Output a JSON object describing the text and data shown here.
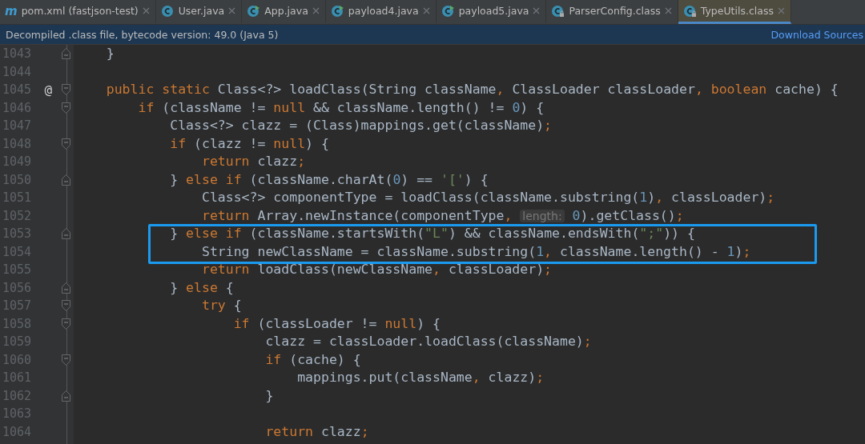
{
  "tabs": [
    {
      "label": "pom.xml (fastjson-test)",
      "kind": "maven",
      "icon_letter": "m",
      "selected": false
    },
    {
      "label": "User.java",
      "kind": "class",
      "selected": false
    },
    {
      "label": "App.java",
      "kind": "runnable",
      "selected": false
    },
    {
      "label": "payload4.java",
      "kind": "runnable",
      "selected": false
    },
    {
      "label": "payload5.java",
      "kind": "runnable",
      "selected": false
    },
    {
      "label": "ParserConfig.class",
      "kind": "locked",
      "selected": false
    },
    {
      "label": "TypeUtils.class",
      "kind": "locked",
      "selected": true
    }
  ],
  "banner": {
    "message": "Decompiled .class file, bytecode version: 49.0 (Java 5)",
    "link": "Download Sources"
  },
  "lines": [
    {
      "number": "1043",
      "fold_start": false,
      "fold_end": true,
      "boxed": false,
      "tokens": [
        {
          "kind": "plain",
          "text": "    }"
        }
      ]
    },
    {
      "number": "1044",
      "fold_start": false,
      "fold_end": false,
      "boxed": false
    },
    {
      "number": "1045",
      "marker": "@",
      "fold_start": true,
      "fold_end": false,
      "boxed": false,
      "tokens": [
        {
          "kind": "kw",
          "text": "    public static"
        },
        {
          "kind": "plain",
          "text": " Class<?> loadClass(String className"
        },
        {
          "kind": "punct",
          "text": ","
        },
        {
          "kind": "plain",
          "text": " ClassLoader classLoader"
        },
        {
          "kind": "punct",
          "text": ","
        },
        {
          "kind": "kw",
          "text": " boolean"
        },
        {
          "kind": "plain",
          "text": " cache) {"
        }
      ]
    },
    {
      "number": "1046",
      "fold_start": true,
      "fold_end": false,
      "boxed": false,
      "tokens": [
        {
          "kind": "kw",
          "text": "        if"
        },
        {
          "kind": "plain",
          "text": " (className != "
        },
        {
          "kind": "kw",
          "text": "null"
        },
        {
          "kind": "plain",
          "text": " && className.length() != "
        },
        {
          "kind": "num",
          "text": "0"
        },
        {
          "kind": "plain",
          "text": ") {"
        }
      ]
    },
    {
      "number": "1047",
      "fold_start": false,
      "fold_end": false,
      "boxed": false,
      "tokens": [
        {
          "kind": "plain",
          "text": "            Class<?> clazz = (Class)mappings.get(className)"
        },
        {
          "kind": "punct",
          "text": ";"
        }
      ]
    },
    {
      "number": "1048",
      "fold_start": true,
      "fold_end": false,
      "boxed": false,
      "tokens": [
        {
          "kind": "kw",
          "text": "            if"
        },
        {
          "kind": "plain",
          "text": " (clazz != "
        },
        {
          "kind": "kw",
          "text": "null"
        },
        {
          "kind": "plain",
          "text": ") {"
        }
      ]
    },
    {
      "number": "1049",
      "fold_start": false,
      "fold_end": false,
      "boxed": false,
      "tokens": [
        {
          "kind": "kw",
          "text": "                return"
        },
        {
          "kind": "plain",
          "text": " clazz"
        },
        {
          "kind": "punct",
          "text": ";"
        }
      ]
    },
    {
      "number": "1050",
      "fold_start": false,
      "fold_end": true,
      "boxed": false,
      "tokens": [
        {
          "kind": "plain",
          "text": "            } "
        },
        {
          "kind": "kw",
          "text": "else if"
        },
        {
          "kind": "plain",
          "text": " (className.charAt("
        },
        {
          "kind": "num",
          "text": "0"
        },
        {
          "kind": "plain",
          "text": ") == "
        },
        {
          "kind": "str",
          "text": "'['"
        },
        {
          "kind": "plain",
          "text": ") {"
        }
      ]
    },
    {
      "number": "1051",
      "fold_start": false,
      "fold_end": false,
      "boxed": false,
      "tokens": [
        {
          "kind": "plain",
          "text": "                Class<?> componentType = loadClass(className.substring("
        },
        {
          "kind": "num",
          "text": "1"
        },
        {
          "kind": "plain",
          "text": ")"
        },
        {
          "kind": "punct",
          "text": ","
        },
        {
          "kind": "plain",
          "text": " classLoader)"
        },
        {
          "kind": "punct",
          "text": ";"
        }
      ]
    },
    {
      "number": "1052",
      "fold_start": false,
      "fold_end": false,
      "boxed": false,
      "tokens": [
        {
          "kind": "kw",
          "text": "                return"
        },
        {
          "kind": "plain",
          "text": " Array.newInstance(componentType"
        },
        {
          "kind": "punct",
          "text": ","
        },
        {
          "kind": "hint",
          "text": "length:"
        },
        {
          "kind": "num",
          "text": "0"
        },
        {
          "kind": "plain",
          "text": ").getClass()"
        },
        {
          "kind": "punct",
          "text": ";"
        }
      ]
    },
    {
      "number": "1053",
      "fold_start": false,
      "fold_end": true,
      "boxed": true,
      "tokens": [
        {
          "kind": "plain",
          "text": "            } "
        },
        {
          "kind": "kw",
          "text": "else if"
        },
        {
          "kind": "plain",
          "text": " (className.startsWith("
        },
        {
          "kind": "str",
          "text": "\"L\""
        },
        {
          "kind": "plain",
          "text": ") && className.endsWith("
        },
        {
          "kind": "str",
          "text": "\";\""
        },
        {
          "kind": "plain",
          "text": ")) {"
        }
      ]
    },
    {
      "number": "1054",
      "fold_start": false,
      "fold_end": false,
      "boxed": true,
      "tokens": [
        {
          "kind": "plain",
          "text": "                String newClassName = className.substring("
        },
        {
          "kind": "num",
          "text": "1"
        },
        {
          "kind": "punct",
          "text": ","
        },
        {
          "kind": "plain",
          "text": " className.length() - "
        },
        {
          "kind": "num",
          "text": "1"
        },
        {
          "kind": "plain",
          "text": ")"
        },
        {
          "kind": "punct",
          "text": ";"
        }
      ]
    },
    {
      "number": "1055",
      "fold_start": false,
      "fold_end": false,
      "boxed": false,
      "tokens": [
        {
          "kind": "kw",
          "text": "                return"
        },
        {
          "kind": "plain",
          "text": " loadClass(newClassName"
        },
        {
          "kind": "punct",
          "text": ","
        },
        {
          "kind": "plain",
          "text": " classLoader)"
        },
        {
          "kind": "punct",
          "text": ";"
        }
      ]
    },
    {
      "number": "1056",
      "fold_start": false,
      "fold_end": true,
      "boxed": false,
      "tokens": [
        {
          "kind": "plain",
          "text": "            } "
        },
        {
          "kind": "kw",
          "text": "else"
        },
        {
          "kind": "plain",
          "text": " {"
        }
      ]
    },
    {
      "number": "1057",
      "fold_start": true,
      "fold_end": false,
      "boxed": false,
      "tokens": [
        {
          "kind": "kw",
          "text": "                try"
        },
        {
          "kind": "plain",
          "text": " {"
        }
      ]
    },
    {
      "number": "1058",
      "fold_start": true,
      "fold_end": false,
      "boxed": false,
      "tokens": [
        {
          "kind": "kw",
          "text": "                    if"
        },
        {
          "kind": "plain",
          "text": " (classLoader != "
        },
        {
          "kind": "kw",
          "text": "null"
        },
        {
          "kind": "plain",
          "text": ") {"
        }
      ]
    },
    {
      "number": "1059",
      "fold_start": false,
      "fold_end": false,
      "boxed": false,
      "tokens": [
        {
          "kind": "plain",
          "text": "                        clazz = classLoader.loadClass(className)"
        },
        {
          "kind": "punct",
          "text": ";"
        }
      ]
    },
    {
      "number": "1060",
      "fold_start": true,
      "fold_end": false,
      "boxed": false,
      "tokens": [
        {
          "kind": "kw",
          "text": "                        if"
        },
        {
          "kind": "plain",
          "text": " (cache) {"
        }
      ]
    },
    {
      "number": "1061",
      "fold_start": false,
      "fold_end": false,
      "boxed": false,
      "tokens": [
        {
          "kind": "plain",
          "text": "                            mappings.put(className"
        },
        {
          "kind": "punct",
          "text": ","
        },
        {
          "kind": "plain",
          "text": " clazz)"
        },
        {
          "kind": "punct",
          "text": ";"
        }
      ]
    },
    {
      "number": "1062",
      "fold_start": false,
      "fold_end": true,
      "boxed": false,
      "tokens": [
        {
          "kind": "plain",
          "text": "                        }"
        }
      ]
    },
    {
      "number": "1063",
      "fold_start": false,
      "fold_end": false,
      "boxed": false
    },
    {
      "number": "1064",
      "fold_start": false,
      "fold_end": false,
      "boxed": false,
      "tokens": [
        {
          "kind": "kw",
          "text": "                        return"
        },
        {
          "kind": "plain",
          "text": " clazz"
        },
        {
          "kind": "punct",
          "text": ";"
        }
      ]
    }
  ]
}
